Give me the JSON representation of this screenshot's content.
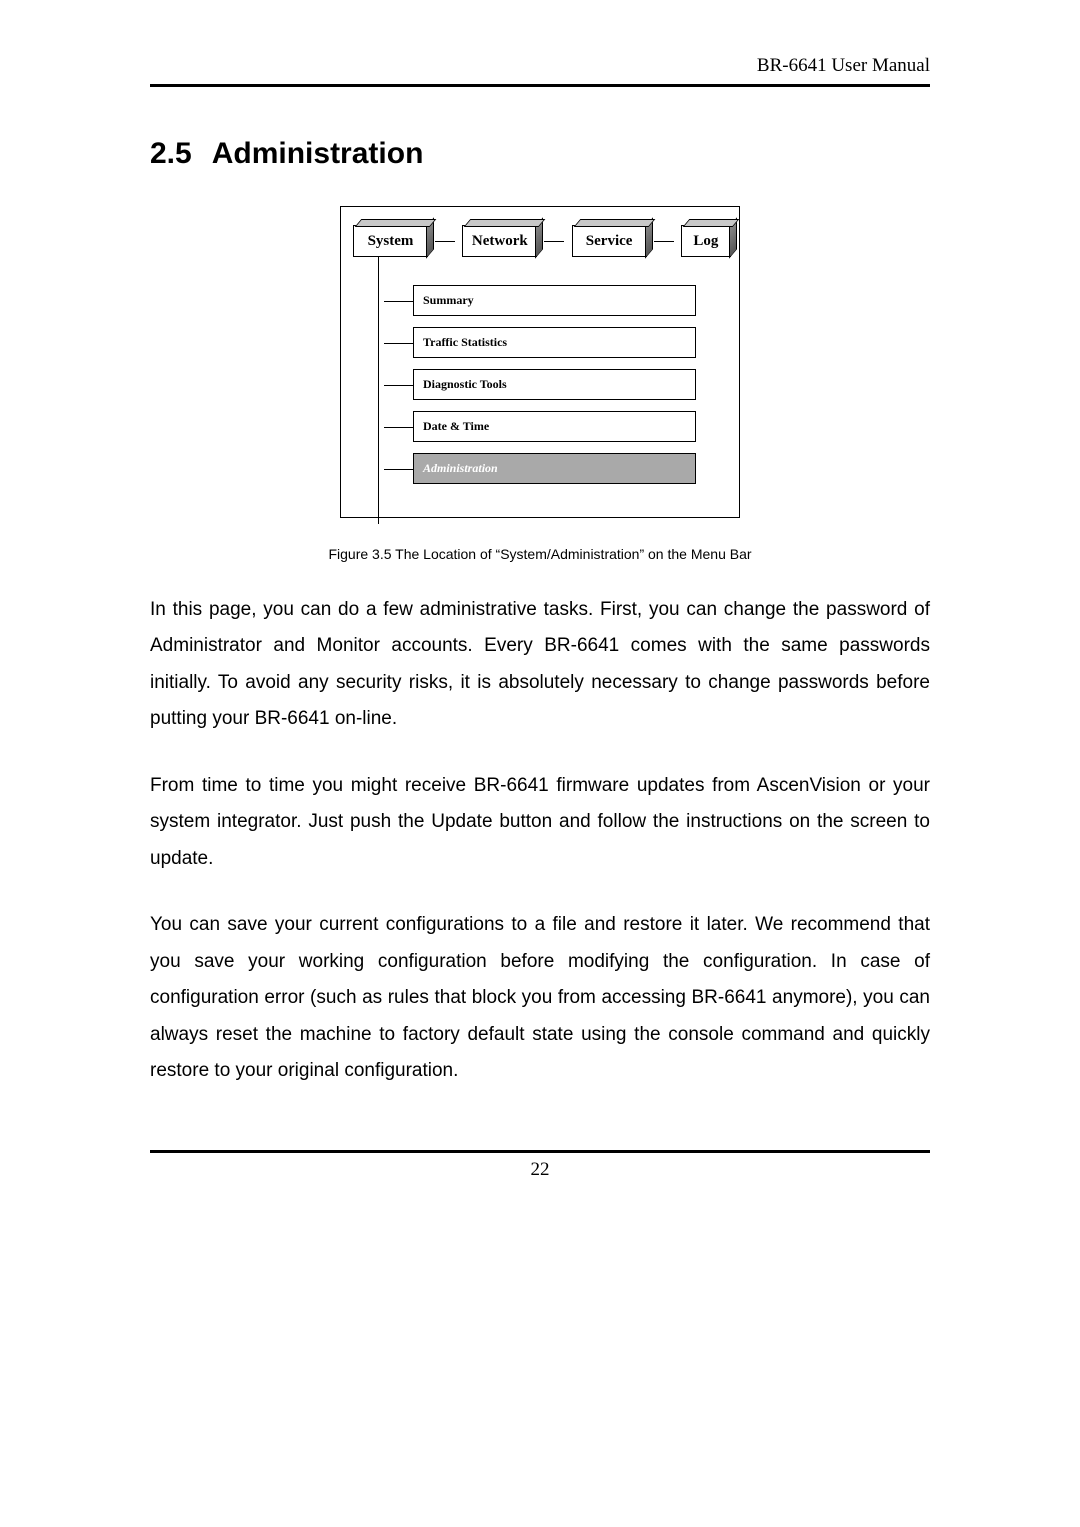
{
  "header": {
    "doc_title": "BR-6641 User Manual"
  },
  "section": {
    "number": "2.5",
    "title": "Administration"
  },
  "diagram": {
    "tabs": [
      "System",
      "Network",
      "Service",
      "Log"
    ],
    "submenu": [
      {
        "label": "Summary",
        "active": false
      },
      {
        "label": "Traffic Statistics",
        "active": false
      },
      {
        "label": "Diagnostic Tools",
        "active": false
      },
      {
        "label": "Date & Time",
        "active": false
      },
      {
        "label": "Administration",
        "active": true
      }
    ]
  },
  "figure_caption": "Figure 3.5  The Location of “System/Administration” on the Menu Bar",
  "paragraphs": {
    "p1": "In this page, you can do a few administrative tasks. First, you can change the password of Administrator and Monitor accounts. Every BR-6641 comes with the same passwords initially. To avoid any security risks, it is absolutely necessary to change passwords before putting your BR-6641 on-line.",
    "p2": "From time to time you might receive BR-6641 firmware updates from AscenVision or your system integrator. Just push the Update button and follow the instructions on the screen to update.",
    "p3": "You can save your current configurations to a file and restore it later. We recommend that you save your working configuration before modifying the configuration. In case of configuration error (such as rules that block you from accessing BR-6641 anymore), you can always reset the machine to factory default state using the console command and quickly restore to your original configuration."
  },
  "page_number": "22"
}
